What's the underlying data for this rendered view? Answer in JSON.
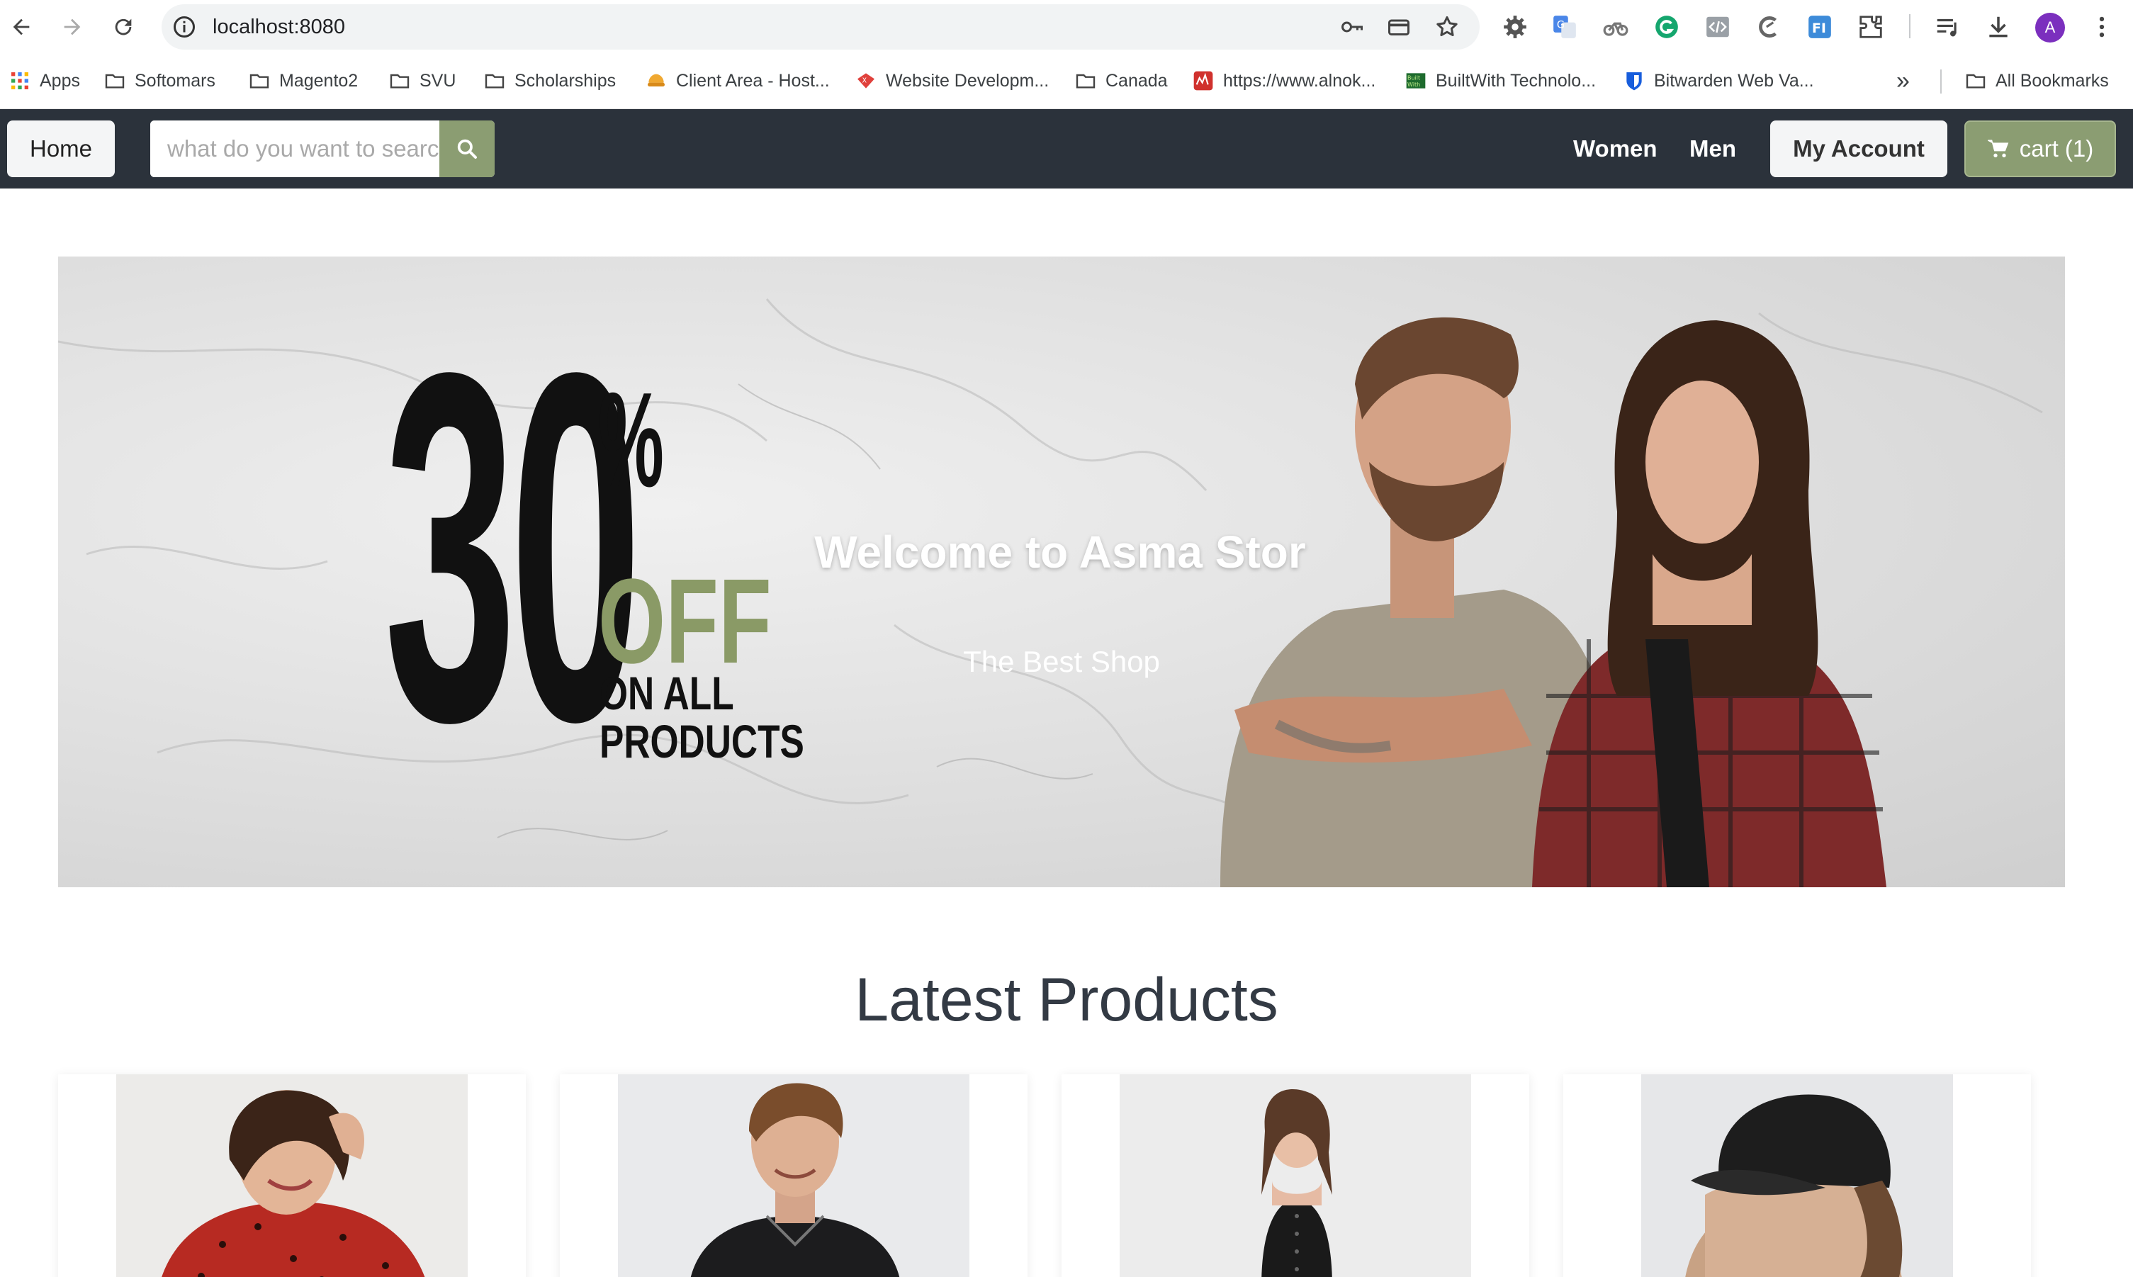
{
  "browser": {
    "url": "localhost:8080",
    "profile_initial": "A"
  },
  "bookmarks": {
    "items": [
      {
        "label": "Apps",
        "icon": "apps-grid-icon"
      },
      {
        "label": "Softomars",
        "icon": "folder-icon"
      },
      {
        "label": "Magento2",
        "icon": "folder-icon"
      },
      {
        "label": "SVU",
        "icon": "folder-icon"
      },
      {
        "label": "Scholarships",
        "icon": "folder-icon"
      },
      {
        "label": "Client Area - Host...",
        "icon": "site-favicon"
      },
      {
        "label": "Website Developm...",
        "icon": "site-favicon"
      },
      {
        "label": "Canada",
        "icon": "folder-icon"
      },
      {
        "label": "https://www.alnok...",
        "icon": "site-favicon"
      },
      {
        "label": "BuiltWith Technolo...",
        "icon": "site-favicon"
      },
      {
        "label": "Bitwarden Web Va...",
        "icon": "bitwarden-icon"
      }
    ],
    "all_bookmarks": "All Bookmarks",
    "overflow": "»"
  },
  "nav": {
    "home": "Home",
    "search_placeholder": "what do you want to search",
    "women": "Women",
    "men": "Men",
    "account": "My Account",
    "cart": "cart (1)"
  },
  "colors": {
    "nav_bg": "#2b323b",
    "accent": "#8b9d72",
    "promo_off": "#8a9a66"
  },
  "hero": {
    "promo_number": "30",
    "promo_percent": "%",
    "promo_off": "OFF",
    "promo_line1": "ON ALL",
    "promo_line2": "PRODUCTS",
    "title": "Welcome to Asma Stor",
    "subtitle": "The Best Shop"
  },
  "products": {
    "title": "Latest Products",
    "cards": [
      {
        "image": "woman-red-shirt"
      },
      {
        "image": "man-black-polo"
      },
      {
        "image": "woman-black-dress"
      },
      {
        "image": "woman-black-cap"
      }
    ]
  }
}
